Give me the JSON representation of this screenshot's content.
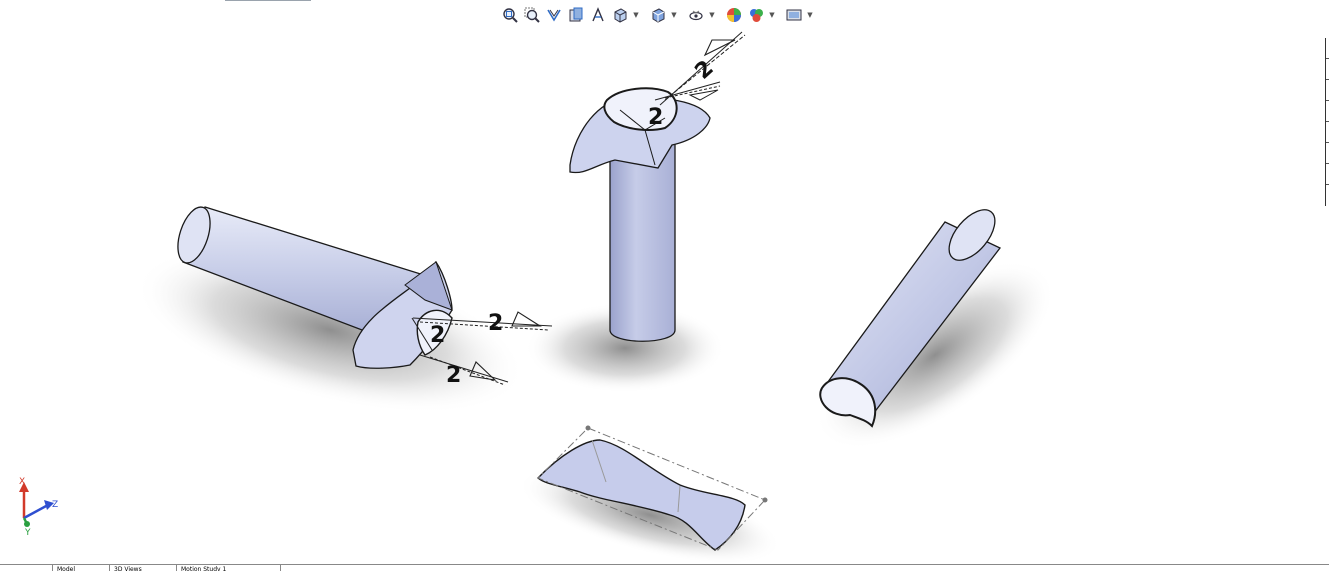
{
  "toolbar": {
    "items": [
      {
        "name": "zoom-to-fit-icon"
      },
      {
        "name": "zoom-to-area-icon"
      },
      {
        "name": "previous-view-icon"
      },
      {
        "name": "section-view-icon"
      },
      {
        "name": "dynamic-annotation-icon"
      },
      {
        "name": "view-orientation-icon"
      },
      {
        "name": "display-style-icon"
      },
      {
        "name": "hide-show-items-icon"
      },
      {
        "name": "edit-appearance-icon"
      },
      {
        "name": "apply-scene-icon"
      },
      {
        "name": "view-settings-icon"
      }
    ],
    "colors": {
      "accent": "#2f6bc4",
      "part_fill": "#c9cee8",
      "part_edge": "#1a1a1a"
    }
  },
  "welds": {
    "w1": "2",
    "w2": "2",
    "w3": "2",
    "w4": "2",
    "w5": "2"
  },
  "triad": {
    "x": "X",
    "y": "Y",
    "z": "Z"
  },
  "bottom_tabs": [
    "",
    "Model",
    "3D Views",
    "Motion Study 1",
    ""
  ]
}
